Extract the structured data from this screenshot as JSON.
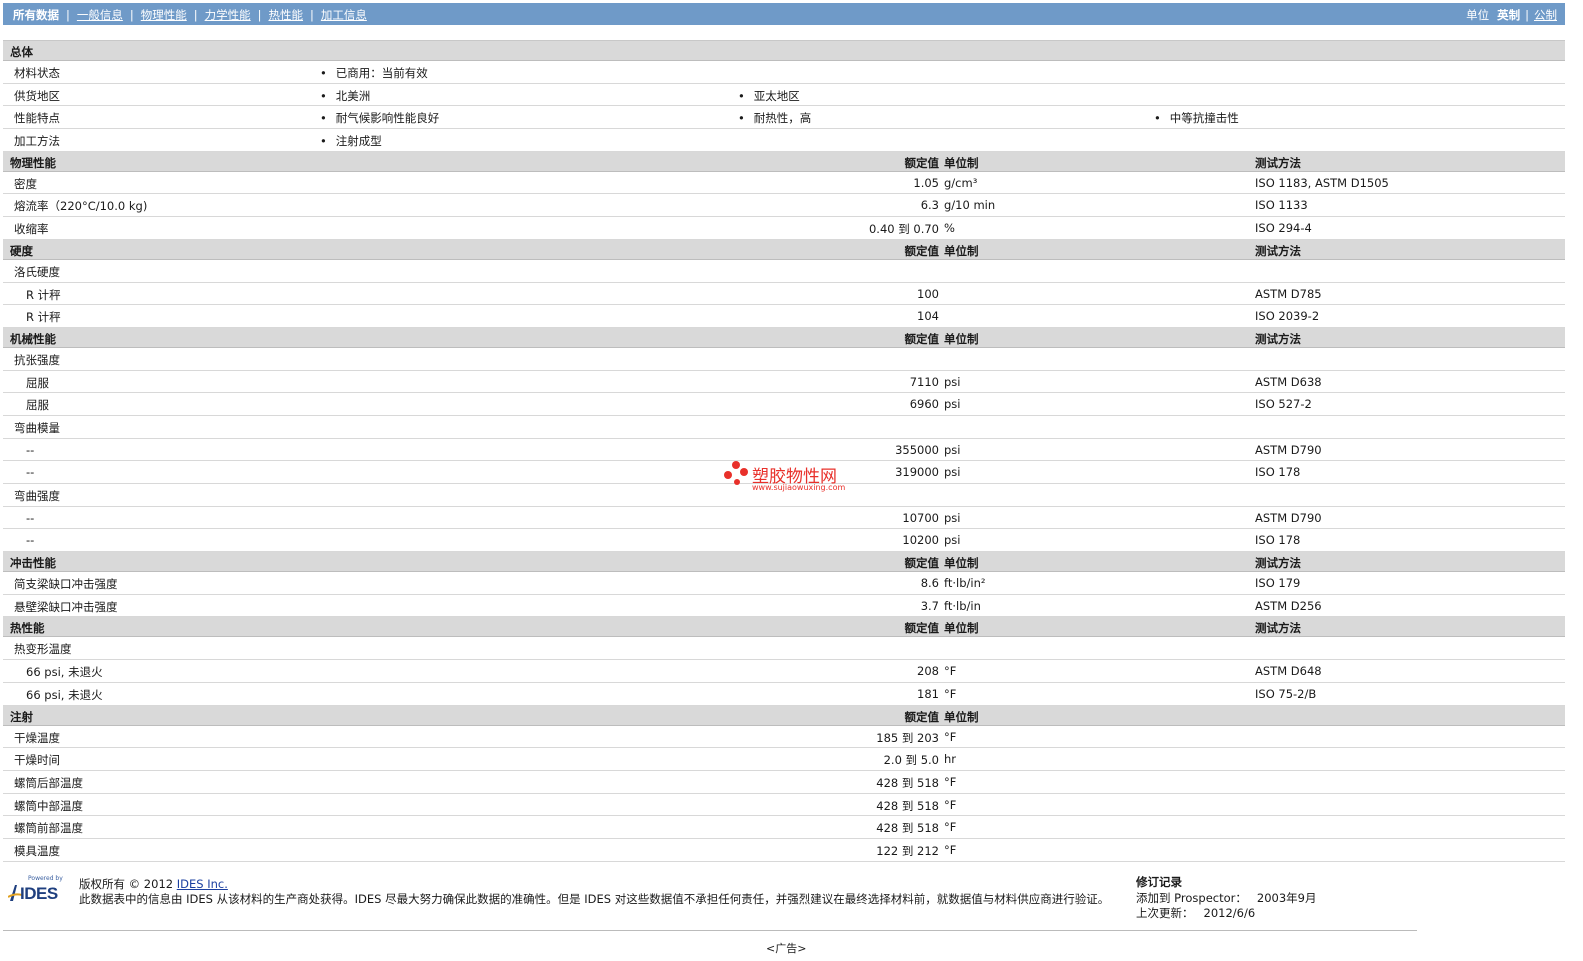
{
  "nav": {
    "items": [
      "所有数据",
      "一般信息",
      "物理性能",
      "力学性能",
      "热性能",
      "加工信息"
    ],
    "unit_label": "单位",
    "unit_selected": "英制",
    "unit_alt": "公制"
  },
  "general": {
    "title": "总体",
    "rows": [
      {
        "label": "材料状态",
        "values": [
          "已商用：当前有效"
        ]
      },
      {
        "label": "供货地区",
        "values": [
          "北美洲",
          "亚太地区"
        ]
      },
      {
        "label": "性能特点",
        "values": [
          "耐气候影响性能良好",
          "耐热性，高",
          "中等抗撞击性"
        ]
      },
      {
        "label": "加工方法",
        "values": [
          "注射成型"
        ]
      }
    ]
  },
  "headers": {
    "value": "额定值",
    "unit": "单位制",
    "test": "测试方法"
  },
  "physical": {
    "title": "物理性能",
    "rows": [
      {
        "label": "密度",
        "value": "1.05",
        "unit": "g/cm³",
        "test": "ISO 1183, ASTM D1505"
      },
      {
        "label": "熔流率（220°C/10.0 kg)",
        "value": "6.3",
        "unit": "g/10 min",
        "test": "ISO 1133"
      },
      {
        "label": "收缩率",
        "value": "0.40 到  0.70",
        "unit": "%",
        "test": "ISO 294-4"
      }
    ]
  },
  "hardness": {
    "title": "硬度",
    "group": "洛氏硬度",
    "rows": [
      {
        "label": "R 计秤",
        "value": "100",
        "unit": "",
        "test": "ASTM D785"
      },
      {
        "label": "R 计秤",
        "value": "104",
        "unit": "",
        "test": "ISO 2039-2"
      }
    ]
  },
  "mechanical": {
    "title": "机械性能",
    "groups": [
      {
        "name": "抗张强度",
        "rows": [
          {
            "label": "屈服",
            "value": "7110",
            "unit": "psi",
            "test": "ASTM D638"
          },
          {
            "label": "屈服",
            "value": "6960",
            "unit": "psi",
            "test": "ISO 527-2"
          }
        ]
      },
      {
        "name": "弯曲模量",
        "rows": [
          {
            "label": "--",
            "value": "355000",
            "unit": "psi",
            "test": "ASTM D790"
          },
          {
            "label": "--",
            "value": "319000",
            "unit": "psi",
            "test": "ISO 178"
          }
        ]
      },
      {
        "name": "弯曲强度",
        "rows": [
          {
            "label": "--",
            "value": "10700",
            "unit": "psi",
            "test": "ASTM D790"
          },
          {
            "label": "--",
            "value": "10200",
            "unit": "psi",
            "test": "ISO 178"
          }
        ]
      }
    ]
  },
  "impact": {
    "title": "冲击性能",
    "rows": [
      {
        "label": "简支梁缺口冲击强度",
        "value": "8.6",
        "unit": "ft·lb/in²",
        "test": "ISO 179"
      },
      {
        "label": "悬壁梁缺口冲击强度",
        "value": "3.7",
        "unit": "ft·lb/in",
        "test": "ASTM D256"
      }
    ]
  },
  "thermal": {
    "title": "热性能",
    "group": "热变形温度",
    "rows": [
      {
        "label": "66 psi, 未退火",
        "value": "208",
        "unit": "°F",
        "test": "ASTM D648"
      },
      {
        "label": "66 psi, 未退火",
        "value": "181",
        "unit": "°F",
        "test": "ISO 75-2/B"
      }
    ]
  },
  "injection": {
    "title": "注射",
    "rows": [
      {
        "label": "干燥温度",
        "value": "185 到  203",
        "unit": "°F"
      },
      {
        "label": "干燥时间",
        "value": "2.0 到  5.0",
        "unit": "hr"
      },
      {
        "label": "螺筒后部温度",
        "value": "428 到  518",
        "unit": "°F"
      },
      {
        "label": "螺筒中部温度",
        "value": "428 到  518",
        "unit": "°F"
      },
      {
        "label": "螺筒前部温度",
        "value": "428 到  518",
        "unit": "°F"
      },
      {
        "label": "模具温度",
        "value": "122 到  212",
        "unit": "°F"
      }
    ]
  },
  "watermark": {
    "text": "塑胶物性网",
    "url": "www.sujiaowuxing.com",
    "color": "#e8302a"
  },
  "footer": {
    "logo_powered": "Powered by",
    "logo_brand": "IDES",
    "copyright_prefix": "版权所有 © 2012",
    "copyright_link": "IDES Inc.",
    "disclaimer": "此数据表中的信息由 IDES 从该材料的生产商处获得。IDES 尽最大努力确保此数据的准确性。但是 IDES 对这些数据值不承担任何责任，并强烈建议在最终选择材料前，就数据值与材料供应商进行验证。",
    "revision_title": "修订记录",
    "added_label": "添加到 Prospector：",
    "added_value": "2003年9月",
    "updated_label": "上次更新：",
    "updated_value": "2012/6/6",
    "ad": "<广告>"
  },
  "colors": {
    "nav_bg": "#6f9ac8",
    "section_bg": "#d9d9d9",
    "link": "#1a3fa0"
  }
}
